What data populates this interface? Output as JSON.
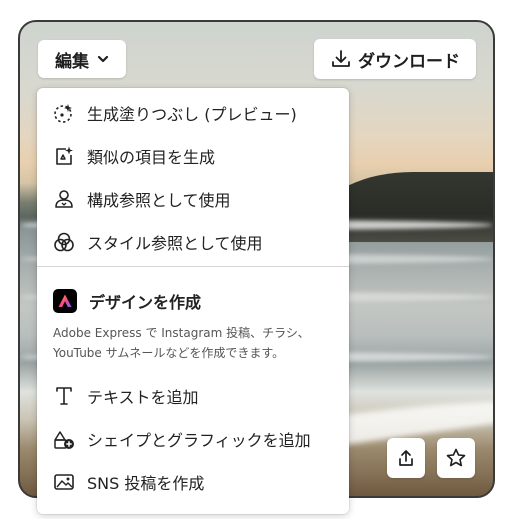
{
  "toolbar": {
    "edit_label": "編集",
    "download_label": "ダウンロード"
  },
  "menu": {
    "items": [
      {
        "label": "生成塗りつぶし (プレビュー)",
        "icon": "generative-fill-icon"
      },
      {
        "label": "類似の項目を生成",
        "icon": "generate-similar-icon"
      },
      {
        "label": "構成参照として使用",
        "icon": "composition-reference-icon"
      },
      {
        "label": "スタイル参照として使用",
        "icon": "style-reference-icon"
      }
    ],
    "express_section": {
      "title": "デザインを作成",
      "icon": "adobe-express-icon",
      "description_line1": "Adobe Express で Instagram 投稿、チラシ、",
      "description_line2": "YouTube サムネールなどを作成できます。"
    },
    "design_items": [
      {
        "label": "テキストを追加",
        "icon": "text-icon"
      },
      {
        "label": "シェイプとグラフィックを追加",
        "icon": "shapes-add-icon"
      },
      {
        "label": "SNS 投稿を作成",
        "icon": "image-post-icon"
      }
    ]
  },
  "actions": {
    "share_icon": "share-icon",
    "favorite_icon": "star-icon"
  },
  "colors": {
    "menu_background": "#ffffff",
    "text": "#222222",
    "divider": "#d6d6d6",
    "express_gradient": [
      "#ff4885",
      "#ffb12b",
      "#7a5cff"
    ]
  }
}
